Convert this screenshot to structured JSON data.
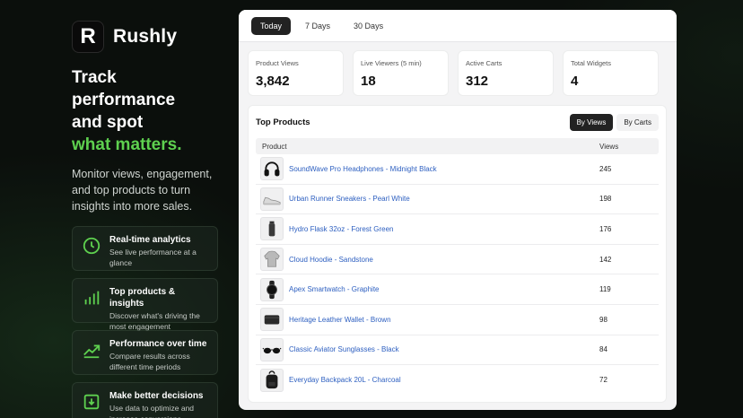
{
  "brand": {
    "logo_letter": "R",
    "name": "Rushly"
  },
  "hero": {
    "line1": "Track performance",
    "line2": "and spot",
    "accent": "what matters.",
    "subtitle": "Monitor views, engagement, and top products to turn insights into more sales."
  },
  "features": [
    {
      "title": "Real-time analytics",
      "desc": "See live performance at a glance",
      "icon": "clock-icon"
    },
    {
      "title": "Top products & insights",
      "desc": "Discover what's driving the most engagement",
      "icon": "bar-chart-icon"
    },
    {
      "title": "Performance over time",
      "desc": "Compare results across different time periods",
      "icon": "trend-icon"
    },
    {
      "title": "Make better decisions",
      "desc": "Use data to optimize and increase conversions",
      "icon": "download-icon"
    }
  ],
  "tabs": [
    "Today",
    "7 Days",
    "30 Days"
  ],
  "stats": [
    {
      "label": "Product Views",
      "value": "3,842"
    },
    {
      "label": "Live Viewers (5 min)",
      "value": "18"
    },
    {
      "label": "Active Carts",
      "value": "312"
    },
    {
      "label": "Total Widgets",
      "value": "4"
    }
  ],
  "top_products": {
    "title": "Top Products",
    "toggle": [
      "By Views",
      "By Carts"
    ],
    "columns": [
      "Product",
      "Views"
    ],
    "rows": [
      {
        "name": "SoundWave Pro Headphones - Midnight Black",
        "views": "245",
        "icon": "headphones-icon"
      },
      {
        "name": "Urban Runner Sneakers - Pearl White",
        "views": "198",
        "icon": "sneaker-icon"
      },
      {
        "name": "Hydro Flask 32oz - Forest Green",
        "views": "176",
        "icon": "bottle-icon"
      },
      {
        "name": "Cloud Hoodie - Sandstone",
        "views": "142",
        "icon": "hoodie-icon"
      },
      {
        "name": "Apex Smartwatch - Graphite",
        "views": "119",
        "icon": "watch-icon"
      },
      {
        "name": "Heritage Leather Wallet - Brown",
        "views": "98",
        "icon": "wallet-icon"
      },
      {
        "name": "Classic Aviator Sunglasses - Black",
        "views": "84",
        "icon": "sunglasses-icon"
      },
      {
        "name": "Everyday Backpack 20L - Charcoal",
        "views": "72",
        "icon": "backpack-icon"
      }
    ]
  },
  "colors": {
    "accent": "#5ed04f",
    "link": "#2d5fc0",
    "dark": "#222222"
  }
}
